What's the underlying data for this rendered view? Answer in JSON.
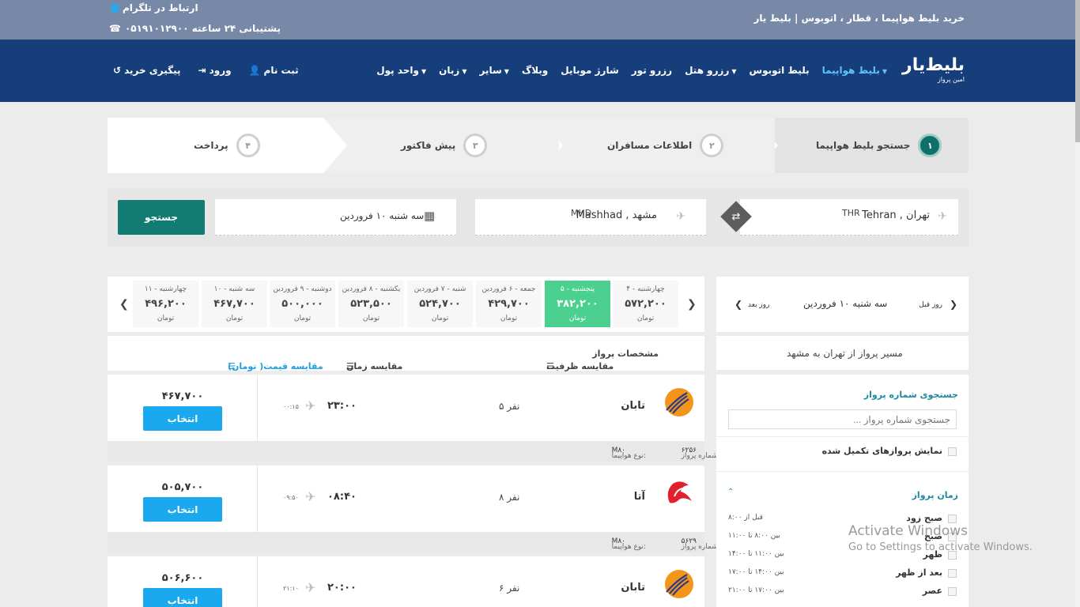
{
  "topbar": {
    "tagline": "خرید بلیط هواپیما ، قطار ، اتوبوس | بلیط یار",
    "telegram": "ارتباط در تلگرام",
    "phone": "۰۵۱۹۱۰۱۲۹۰۰ پشتیبانی ۲۴ ساعته",
    "colors": {
      "bar": "#7889a8",
      "nav": "#163e7a",
      "accent": "#5fc3ff"
    }
  },
  "brand": {
    "logo": "بلیط‌یار",
    "sub": "امین پرواز"
  },
  "menu": {
    "items": [
      {
        "label": "بلیط هواپیما",
        "active": true,
        "dropdown": true
      },
      {
        "label": "بلیط اتوبوس",
        "active": false,
        "dropdown": false
      },
      {
        "label": "رزرو هتل",
        "active": false,
        "dropdown": true
      },
      {
        "label": "رزرو تور",
        "active": false,
        "dropdown": false
      },
      {
        "label": "شارژ موبایل",
        "active": false,
        "dropdown": false
      },
      {
        "label": "وبلاگ",
        "active": false,
        "dropdown": false
      },
      {
        "label": "سایر",
        "active": false,
        "dropdown": true
      },
      {
        "label": "زبان",
        "active": false,
        "dropdown": true
      },
      {
        "label": "واحد پول",
        "active": false,
        "dropdown": true
      }
    ],
    "register": "ثبت نام",
    "login": "ورود",
    "track": "پیگیری خرید"
  },
  "steps": [
    {
      "num": "۱",
      "label": "جستجو بلیط هواپیما",
      "active": true
    },
    {
      "num": "۲",
      "label": "اطلاعات مسافران",
      "active": false
    },
    {
      "num": "۳",
      "label": "پیش فاکتور",
      "active": false
    },
    {
      "num": "۴",
      "label": "پرداخت",
      "active": false
    }
  ],
  "search": {
    "origin": "Tehran , تهران",
    "origin_code": "THR",
    "dest": "Mashhad , مشهد",
    "dest_code": "MHD",
    "date": "سه شنبه ۱۰ فروردین",
    "button": "جستجو"
  },
  "date_strip": [
    {
      "day": "چهارشنبه - ۴",
      "price": "۵۷۲,۲۰۰",
      "cur": "تومان",
      "selected": false
    },
    {
      "day": "پنجشنبه - ۵",
      "price": "۳۸۲,۲۰۰",
      "cur": "تومان",
      "selected": true
    },
    {
      "day": "جمعه - ۶ فروردین",
      "price": "۴۲۹,۷۰۰",
      "cur": "تومان",
      "selected": false
    },
    {
      "day": "شنبه - ۷ فروردین",
      "price": "۵۲۴,۷۰۰",
      "cur": "تومان",
      "selected": false
    },
    {
      "day": "یکشنبه - ۸ فروردین",
      "price": "۵۲۳,۵۰۰",
      "cur": "تومان",
      "selected": false
    },
    {
      "day": "دوشنبه - ۹ فروردین",
      "price": "۵۰۰,۰۰۰",
      "cur": "تومان",
      "selected": false
    },
    {
      "day": "سه شنبه - ۱۰",
      "price": "۴۶۷,۷۰۰",
      "cur": "تومان",
      "selected": false
    },
    {
      "day": "چهارشنبه - ۱۱",
      "price": "۴۹۶,۲۰۰",
      "cur": "تومان",
      "selected": false
    }
  ],
  "sort": {
    "spec": "مشخصات پرواز",
    "capacity": "مقایسه ظرفیت",
    "time": "مقایسه زمان",
    "price": "مقایسه قیمت( تومان)"
  },
  "flights": [
    {
      "airline": "تابان",
      "logo": "taban-logo",
      "capacity": "۵ نفر",
      "dep": "۲۳:۰۰",
      "arr": "۰۰:۱۵",
      "price": "۴۶۷,۷۰۰",
      "select": "انتخاب",
      "flight_no_label": "شماره پرواز:",
      "flight_no": "۶۲۵۶",
      "aircraft_label": "نوع هواپیما:",
      "aircraft": "M۸۰"
    },
    {
      "airline": "آتا",
      "logo": "ata-logo",
      "capacity": "۸ نفر",
      "dep": "۰۸:۴۰",
      "arr": "۰۹:۵۰",
      "price": "۵۰۵,۷۰۰",
      "select": "انتخاب",
      "flight_no_label": "شماره پرواز:",
      "flight_no": "۵۶۲۹",
      "aircraft_label": "نوع هواپیما:",
      "aircraft": "M۸۰"
    },
    {
      "airline": "تابان",
      "logo": "taban-logo",
      "capacity": "۶ نفر",
      "dep": "۲۰:۰۰",
      "arr": "۲۱:۱۰",
      "price": "۵۰۶,۶۰۰",
      "select": "انتخاب",
      "flight_no_label": "",
      "flight_no": "",
      "aircraft_label": "",
      "aircraft": ""
    }
  ],
  "sidebar": {
    "prev_day": "روز قبل",
    "next_day": "روز بعد",
    "current_date": "سه شنبه ۱۰ فروردین",
    "route": "مسیر پرواز از تهران به مشهد",
    "flight_search_title": "جستجوی شماره پرواز",
    "flight_search_placeholder": "جستجوی شماره پرواز ...",
    "show_full": "نمایش پروازهای تکمیل شده",
    "time_title": "زمان پرواز",
    "time_filters": [
      {
        "label": "صبح زود",
        "range": "قبل از ۸:۰۰"
      },
      {
        "label": "صبح",
        "range": "بین ۸:۰۰ تا ۱۱:۰۰"
      },
      {
        "label": "ظهر",
        "range": "بین ۱۱:۰۰ تا ۱۴:۰۰"
      },
      {
        "label": "بعد از ظهر",
        "range": "بین ۱۴:۰۰ تا ۱۷:۰۰"
      },
      {
        "label": "عصر",
        "range": "بین ۱۷:۰۰ تا ۲۱:۰۰"
      }
    ]
  },
  "watermark": {
    "line1": "Activate Windows",
    "line2": "Go to Settings to activate Windows."
  }
}
